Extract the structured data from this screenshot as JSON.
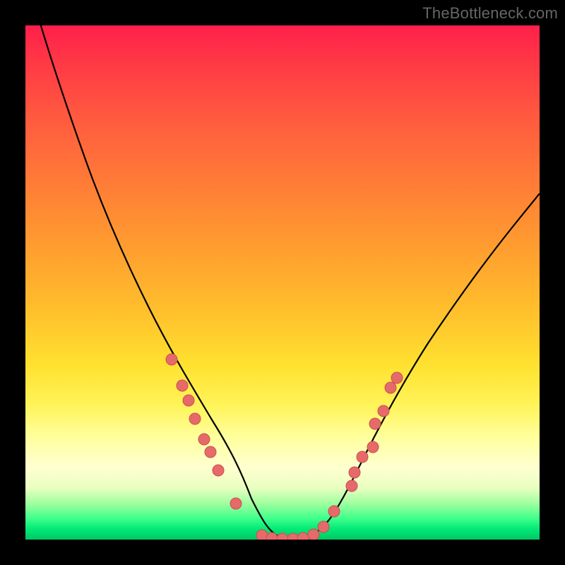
{
  "watermark": "TheBottleneck.com",
  "colors": {
    "frame": "#000000",
    "curve": "#000000",
    "dot_fill": "#e66a6a",
    "dot_stroke": "#c94f4f",
    "gradient_top": "#ff1f4a",
    "gradient_bottom": "#00c864"
  },
  "chart_data": {
    "type": "line",
    "title": "",
    "xlabel": "",
    "ylabel": "",
    "xlim": [
      0,
      100
    ],
    "ylim": [
      0,
      100
    ],
    "grid": false,
    "legend": false,
    "series": [
      {
        "name": "bottleneck-curve",
        "x": [
          3,
          6,
          10,
          14,
          18,
          22,
          26,
          28,
          30,
          32,
          34,
          36,
          38,
          40,
          42,
          44,
          46,
          48,
          50,
          52,
          54,
          56,
          58,
          62,
          66,
          70,
          74,
          78,
          82,
          86,
          90,
          94,
          98,
          100
        ],
        "y": [
          100,
          90,
          78,
          67,
          57,
          48,
          40,
          36,
          32,
          28,
          24,
          20,
          16,
          12,
          8,
          5,
          2,
          0.5,
          0,
          0,
          0,
          1,
          3,
          8,
          14,
          20,
          26,
          32,
          38,
          44,
          50,
          55,
          60,
          63
        ]
      }
    ],
    "markers": [
      {
        "x": 28.5,
        "y": 35
      },
      {
        "x": 30.5,
        "y": 30
      },
      {
        "x": 31.8,
        "y": 27
      },
      {
        "x": 33.0,
        "y": 23.5
      },
      {
        "x": 34.8,
        "y": 19.5
      },
      {
        "x": 36.0,
        "y": 17
      },
      {
        "x": 37.5,
        "y": 13.5
      },
      {
        "x": 41.0,
        "y": 7
      },
      {
        "x": 46.0,
        "y": 0.8
      },
      {
        "x": 48.0,
        "y": 0.3
      },
      {
        "x": 50.0,
        "y": 0.2
      },
      {
        "x": 52.0,
        "y": 0.2
      },
      {
        "x": 54.0,
        "y": 0.3
      },
      {
        "x": 56.0,
        "y": 0.9
      },
      {
        "x": 58.0,
        "y": 2.5
      },
      {
        "x": 60.0,
        "y": 5.5
      },
      {
        "x": 63.4,
        "y": 10.5
      },
      {
        "x": 64.0,
        "y": 13
      },
      {
        "x": 65.5,
        "y": 16
      },
      {
        "x": 67.5,
        "y": 18
      },
      {
        "x": 68.0,
        "y": 22.5
      },
      {
        "x": 69.7,
        "y": 25
      },
      {
        "x": 71.0,
        "y": 29.5
      },
      {
        "x": 72.3,
        "y": 31.5
      }
    ]
  }
}
